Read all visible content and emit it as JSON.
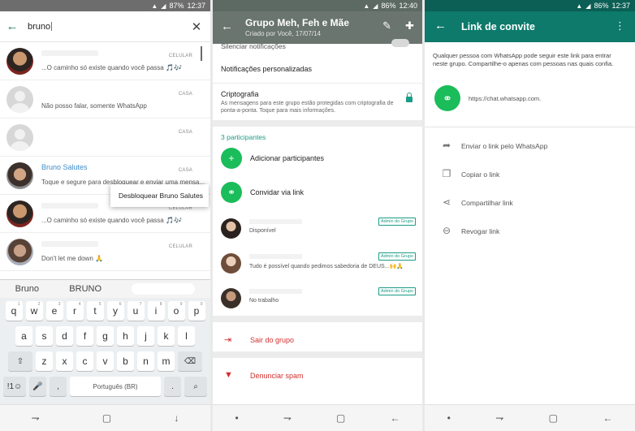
{
  "status": {
    "s1": {
      "battery": "87%",
      "time": "12:37"
    },
    "s2": {
      "battery": "86%",
      "time": "12:40"
    },
    "s3": {
      "battery": "86%",
      "time": "12:37"
    }
  },
  "search": {
    "query": "bruno",
    "chats": [
      {
        "label": "CELULAR",
        "message": "...O caminho  só existe  quando você  passa 🎵🎶"
      },
      {
        "label": "CASA",
        "message": "Não posso falar, somente WhatsApp"
      },
      {
        "label": "CASA",
        "message": ""
      },
      {
        "name": "Bruno Salutes",
        "label": "CASA",
        "message": "Toque e segure para desbloquear e enviar uma mensa..."
      },
      {
        "label": "CELULAR",
        "message": "...O caminho  só existe  quando você  passa 🎵🎶"
      },
      {
        "label": "CELULAR",
        "message": "Don't let me down 🙏"
      }
    ],
    "popup": "Desbloquear Bruno Salutes"
  },
  "keyboard": {
    "suggestions": [
      "Bruno",
      "BRUNO"
    ],
    "row1": [
      "q",
      "w",
      "e",
      "r",
      "t",
      "y",
      "u",
      "i",
      "o",
      "p"
    ],
    "row1_hints": [
      "1",
      "2",
      "3",
      "4",
      "5",
      "6",
      "7",
      "8",
      "9",
      "0"
    ],
    "row2": [
      "a",
      "s",
      "d",
      "f",
      "g",
      "h",
      "j",
      "k",
      "l"
    ],
    "row3": [
      "z",
      "x",
      "c",
      "v",
      "b",
      "n",
      "m"
    ],
    "shift": "⇧",
    "backspace": "⌫",
    "symbols": "!1☺",
    "mic": "🎤",
    "comma": ",",
    "space": "Português (BR)",
    "period": ".",
    "search": "⌕"
  },
  "nav": {
    "recent": "⇁",
    "home": "▢",
    "back": "↓",
    "dot": "•",
    "back2": "←"
  },
  "group": {
    "title": "Grupo Meh, Feh e Mãe",
    "subtitle": "Criado por Você, 17/07/14",
    "silenced": "Silenciar notificações",
    "custom_notifications": "Notificações personalizadas",
    "encryption_title": "Criptografia",
    "encryption_desc": "As mensagens para este grupo estão protegidas com criptografia de ponta-a-ponta. Toque para mais informações.",
    "participants_count": "3 participantes",
    "add_participants": "Adicionar participantes",
    "invite_link": "Convidar via link",
    "members": [
      {
        "status": "Disponível",
        "badge": "Admin do Grupo"
      },
      {
        "status": "Tudo é possível quando pedimos sabedoria de DEUS...🙌🙏",
        "badge": "Admin do Grupo"
      },
      {
        "status": "No trabalho",
        "badge": "Admin do Grupo"
      }
    ],
    "leave": "Sair do grupo",
    "report": "Denunciar spam"
  },
  "invite": {
    "title": "Link de convite",
    "description": "Qualquer pessoa com WhatsApp pode seguir este link para entrar neste grupo. Compartilhe-o apenas com pessoas nas quais confia.",
    "url": "https://chat.whatsapp.com.",
    "options": [
      "Enviar o link pelo WhatsApp",
      "Copiar o link",
      "Compartilhar link",
      "Revogar link"
    ]
  }
}
